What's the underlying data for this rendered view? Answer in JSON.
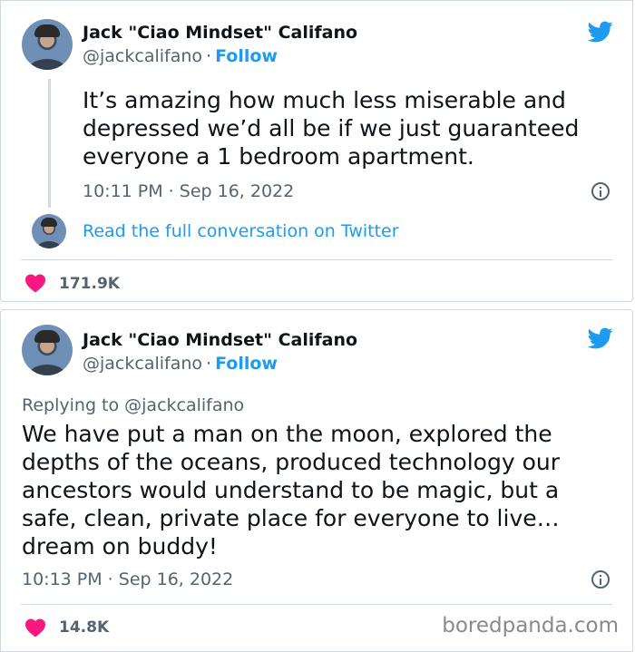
{
  "tweets": [
    {
      "name": "Jack \"Ciao Mindset\" Califano",
      "handle": "@jackcalifano",
      "follow": "Follow",
      "text_lines": [
        "It’s amazing how much less miserable and",
        "depressed we’d all be if we just guaranteed",
        "everyone a 1 bedroom apartment."
      ],
      "time": "10:11 PM · Sep 16, 2022",
      "read_full": "Read the full conversation on Twitter",
      "likes": "171.9K"
    },
    {
      "name": "Jack \"Ciao Mindset\" Califano",
      "handle": "@jackcalifano",
      "follow": "Follow",
      "replying": "Replying to @jackcalifano",
      "text_lines": [
        "We have put a man on the moon, explored the",
        "depths of the oceans, produced technology our",
        "ancestors would understand to be magic, but a",
        "safe, clean, private place for everyone to live…",
        "dream on buddy!"
      ],
      "time": "10:13 PM · Sep 16, 2022",
      "likes": "14.8K"
    }
  ],
  "watermark": "boredpanda.com",
  "colors": {
    "accent": "#1d9bf0",
    "heart": "#f91880",
    "muted": "#536471",
    "border": "#cfd9de"
  },
  "icons": [
    "twitter-bird-icon",
    "info-icon",
    "heart-icon"
  ]
}
